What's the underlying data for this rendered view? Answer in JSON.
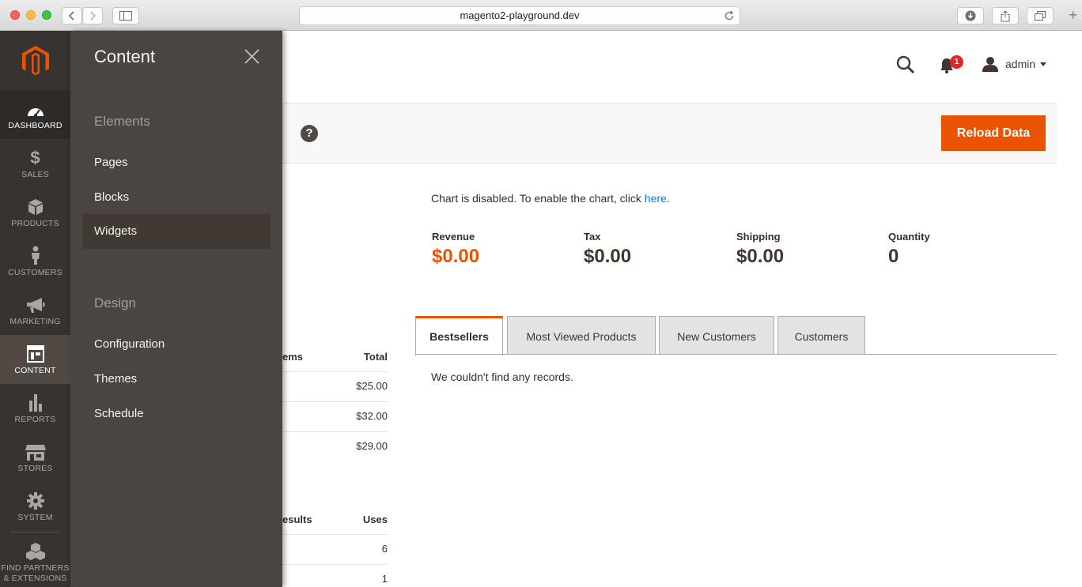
{
  "browser": {
    "url": "magento2-playground.dev"
  },
  "nav": {
    "items": [
      {
        "label": "DASHBOARD",
        "icon": "dashboard-gauge-icon"
      },
      {
        "label": "SALES",
        "icon": "dollar-icon"
      },
      {
        "label": "PRODUCTS",
        "icon": "cube-icon"
      },
      {
        "label": "CUSTOMERS",
        "icon": "person-icon"
      },
      {
        "label": "MARKETING",
        "icon": "megaphone-icon"
      },
      {
        "label": "CONTENT",
        "icon": "layout-icon"
      },
      {
        "label": "REPORTS",
        "icon": "bar-chart-icon"
      },
      {
        "label": "STORES",
        "icon": "storefront-icon"
      },
      {
        "label": "SYSTEM",
        "icon": "gear-icon"
      }
    ],
    "partners_line1": "FIND PARTNERS",
    "partners_line2": "& EXTENSIONS"
  },
  "flyout": {
    "title": "Content",
    "groups": [
      {
        "heading": "Elements",
        "links": [
          "Pages",
          "Blocks",
          "Widgets"
        ]
      },
      {
        "heading": "Design",
        "links": [
          "Configuration",
          "Themes",
          "Schedule"
        ]
      }
    ]
  },
  "header": {
    "notification_count": "1",
    "user": "admin"
  },
  "actions": {
    "help": "?",
    "reload": "Reload Data"
  },
  "dashboard": {
    "chart_msg": "Chart is disabled. To enable the chart, click ",
    "chart_link": "here",
    "chart_msg_end": ".",
    "totals": [
      {
        "label": "Revenue",
        "value": "$0.00"
      },
      {
        "label": "Tax",
        "value": "$0.00"
      },
      {
        "label": "Shipping",
        "value": "$0.00"
      },
      {
        "label": "Quantity",
        "value": "0"
      }
    ],
    "tabs": [
      "Bestsellers",
      "Most Viewed Products",
      "New Customers",
      "Customers"
    ],
    "no_records": "We couldn't find any records."
  },
  "orders_table": {
    "headers": [
      "ems",
      "Total"
    ],
    "rows": [
      "$25.00",
      "$32.00",
      "$29.00"
    ]
  },
  "search_table": {
    "headers": [
      "esults",
      "Uses"
    ],
    "rows": [
      "6",
      "1"
    ]
  },
  "colors": {
    "accent": "#eb5202",
    "nav_bg": "#373330",
    "flyout_bg": "#4a4542",
    "link": "#007bdb"
  }
}
